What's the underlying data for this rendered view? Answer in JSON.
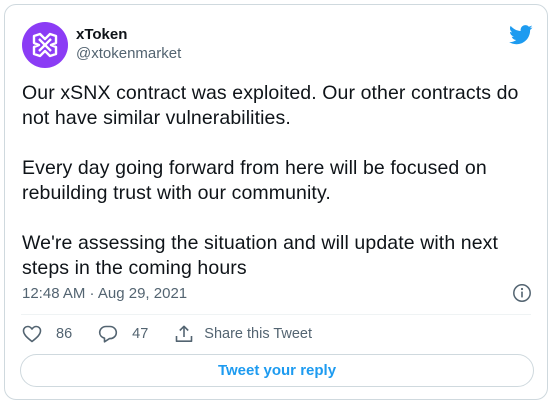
{
  "author": {
    "display_name": "xToken",
    "handle": "@xtokenmarket"
  },
  "tweet": {
    "paragraphs": [
      "Our xSNX contract was exploited. Our other contracts do not have similar vulnerabilities.",
      "Every day going forward from here will be focused on rebuilding trust with our community.",
      "We're assessing the situation and will update with next steps in the coming hours"
    ],
    "timestamp": "12:48 AM · Aug 29, 2021"
  },
  "actions": {
    "likes": "86",
    "replies": "47",
    "share_label": "Share this Tweet"
  },
  "reply_button_label": "Tweet your reply",
  "icons": {
    "avatar": "xtoken-logo-icon",
    "brand": "twitter-bird-icon",
    "info": "info-icon",
    "like": "heart-icon",
    "reply": "reply-bubble-icon",
    "share": "share-icon"
  },
  "colors": {
    "accent": "#1d9bf0",
    "avatar_bg": "#8b3cf5",
    "text_primary": "#0f1419",
    "text_secondary": "#536471",
    "border": "#cfd9de"
  }
}
